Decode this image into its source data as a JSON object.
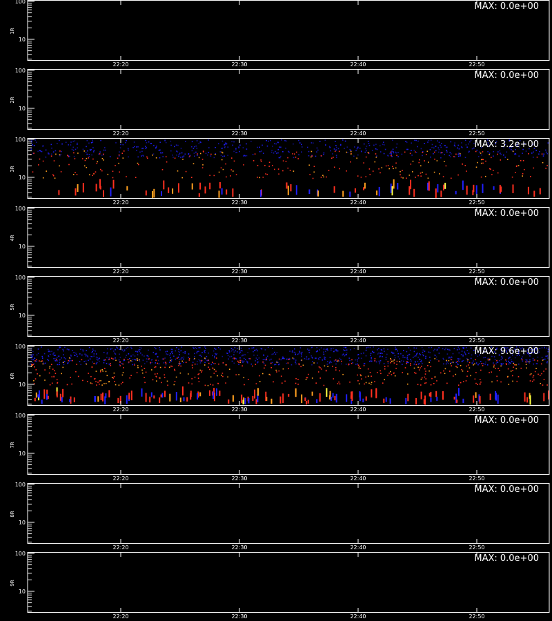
{
  "chart_data": {
    "type": "heatmap",
    "y_scale": "log",
    "y_ticks": [
      "100",
      "10"
    ],
    "x_ticks": [
      "22:20",
      "22:30",
      "22:40",
      "22:50"
    ],
    "colors": {
      "background": "#000000",
      "axis": "#ffffff",
      "low": "#2020ff",
      "mid": "#ff3020",
      "high": "#ffa020",
      "peak": "#ffff40"
    },
    "panels": [
      {
        "label": "1R",
        "max_text": "MAX: 0.0e+00",
        "max": 0.0
      },
      {
        "label": "2R",
        "max_text": "MAX: 0.0e+00",
        "max": 0.0
      },
      {
        "label": "3R",
        "max_text": "MAX: 3.2e+00",
        "max": 3.2
      },
      {
        "label": "4R",
        "max_text": "MAX: 0.0e+00",
        "max": 0.0
      },
      {
        "label": "5R",
        "max_text": "MAX: 0.0e+00",
        "max": 0.0
      },
      {
        "label": "6R",
        "max_text": "MAX: 9.6e+00",
        "max": 9.6
      },
      {
        "label": "7R",
        "max_text": "MAX: 0.0e+00",
        "max": 0.0
      },
      {
        "label": "8R",
        "max_text": "MAX: 0.0e+00",
        "max": 0.0
      },
      {
        "label": "9R",
        "max_text": "MAX: 0.0e+00",
        "max": 0.0
      }
    ],
    "footer": ""
  }
}
